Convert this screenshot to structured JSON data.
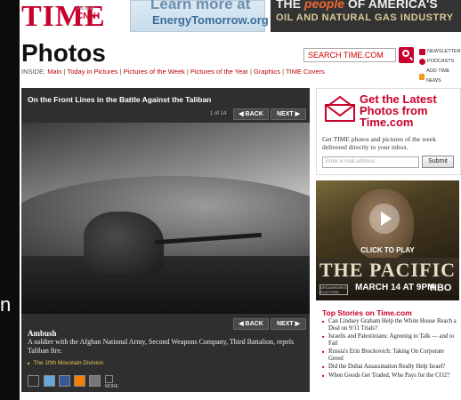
{
  "header": {
    "logo": "TIME",
    "logo_partner_small": "Partner",
    "logo_partner": "CNN",
    "ad1": {
      "line1": "Learn more at",
      "line2": "EnergyTomorrow.org"
    },
    "ad2": {
      "line1_a": "THE ",
      "line1_b": "people",
      "line1_c": " OF AMERICA'S",
      "line2": "OIL AND NATURAL GAS INDUSTRY"
    },
    "section_title": "Photos",
    "inside_prefix": "INSIDE:",
    "inside_links": [
      "Main",
      "Today in Pictures",
      "Pictures of the Week",
      "Pictures of the Year",
      "Graphics",
      "TIME Covers"
    ],
    "search_placeholder": "SEARCH TIME.COM",
    "utility_links": [
      "NEWSLETTER",
      "PODCASTS",
      "ADD TIME NEWS"
    ]
  },
  "gallery": {
    "title": "On the Front Lines in the Battle Against the Taliban",
    "count": "1 of 14",
    "back_label": "◀ BACK",
    "next_label": "NEXT ▶",
    "caption_title": "Ambush",
    "caption_text": "A soldier with the Afghan National Army, Second Weapons Company, Third Battalion, repels Taliban fire.",
    "caption_link": "The 10th Mountain Division",
    "more_label": "MORE"
  },
  "promo": {
    "heading": "Get the Latest Photos from Time.com",
    "text": "Get TIME photos and pictures of the week delivered directly to your inbox.",
    "email_placeholder": "Enter e-mail address",
    "submit_label": "Submit"
  },
  "video_ad": {
    "label": "CLICK TO PLAY"
  },
  "pacific_ad": {
    "title": "THE PACIFIC",
    "date": "MARCH 14 AT 9PM",
    "network": "HBO",
    "badge": "DREAMWORKS PLAYTONE"
  },
  "top_stories": {
    "title": "Top Stories on Time.com",
    "items": [
      "Can Lindsey Graham Help the White House Reach a Deal on 9/11 Trials?",
      "Israelis and Palestinians: Agreeing to Talk — and to Fail",
      "Russia's Erin Brockovich: Taking On Corporate Greed",
      "Did the Dubai Assassination Really Help Israel?",
      "When Goods Get Traded, Who Pays for the CO2?"
    ]
  },
  "left_edge_glyph": "n",
  "colors": {
    "brand_red": "#c8002c",
    "panel": "#2f2f2f",
    "link_gold": "#e8c85a"
  }
}
